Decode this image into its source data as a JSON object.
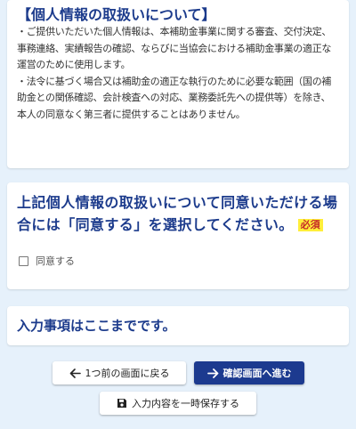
{
  "privacy": {
    "title": "【個人情報の取扱いについて】",
    "paragraph1": "・ご提供いただいた個人情報は、本補助金事業に関する審査、交付決定、事務連絡、実績報告の確認、ならびに当協会における補助金事業の適正な運営のために使用します。",
    "paragraph2": "・法令に基づく場合又は補助金の適正な執行のために必要な範囲（国の補助金との関係確認、会計検査への対応、業務委託先への提供等）を除き、本人の同意なく第三者に提供することはありません。"
  },
  "consent": {
    "question": "上記個人情報の取扱いについて同意いただける場合には「同意する」を選択してください。",
    "required_badge": "必須",
    "checkbox_label": "同意する",
    "checked": false
  },
  "end_notice": "入力事項はここまでです。",
  "buttons": {
    "back_label": "1つ前の画面に戻る",
    "next_label": "確認画面へ進む",
    "save_label": "入力内容を一時保存する"
  },
  "icons": {
    "back": "arrow-left-icon",
    "next": "arrow-right-icon",
    "save": "floppy-disk-icon"
  },
  "colors": {
    "background": "#e6f1fb",
    "heading": "#1c3b8c",
    "primary_button": "#1c3a8f",
    "required_badge_bg": "#ffee3a",
    "required_badge_text": "#c62828"
  }
}
